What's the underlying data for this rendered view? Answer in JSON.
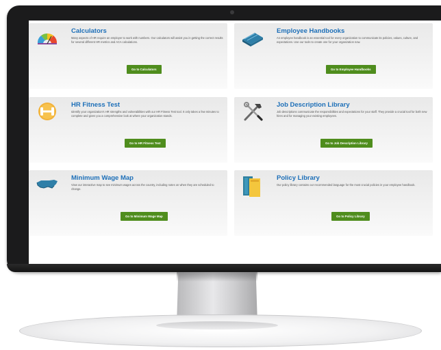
{
  "cards": [
    {
      "title": "Calculators",
      "desc": "Many aspects of HR require an employer to work with numbers. Our calculators will assist you in getting the correct results for several different HR metrics and ACA calculations.",
      "button": "Go to Calculators",
      "icon": "gauge-icon"
    },
    {
      "title": "Employee Handbooks",
      "desc": "An employee handbook is an essential tool for every organization to communicate its policies, values, culture, and expectations. Use our tools to create one for your organization now.",
      "button": "Go to Employee Handbooks",
      "icon": "handbook-icon"
    },
    {
      "title": "HR Fitness Test",
      "desc": "Identify your organization's HR strengths and vulnerabilities with our HR Fitness Test tool. It only takes a few minutes to complete and gives you a comprehensive look at where your organization stands.",
      "button": "Go to HR Fitness Test",
      "icon": "dumbbell-icon"
    },
    {
      "title": "Job Description Library",
      "desc": "Job descriptions communicate the responsibilities and expectations for your staff. They provide a crucial tool for both new hires and for managing your existing employees.",
      "button": "Go to Job Description Library",
      "icon": "tools-icon"
    },
    {
      "title": "Minimum Wage Map",
      "desc": "View our interactive map to see minimum wages across the country, including notes on when they are scheduled to change.",
      "button": "Go to Minimum Wage Map",
      "icon": "us-map-icon"
    },
    {
      "title": "Policy Library",
      "desc": "Our policy library contains our recommended language for the most crucial policies in your employee handbook.",
      "button": "Go to Policy Library",
      "icon": "folders-icon"
    }
  ],
  "colors": {
    "title": "#1d6fb8",
    "button": "#4f8d1d",
    "frame": "#1b1b1c"
  }
}
